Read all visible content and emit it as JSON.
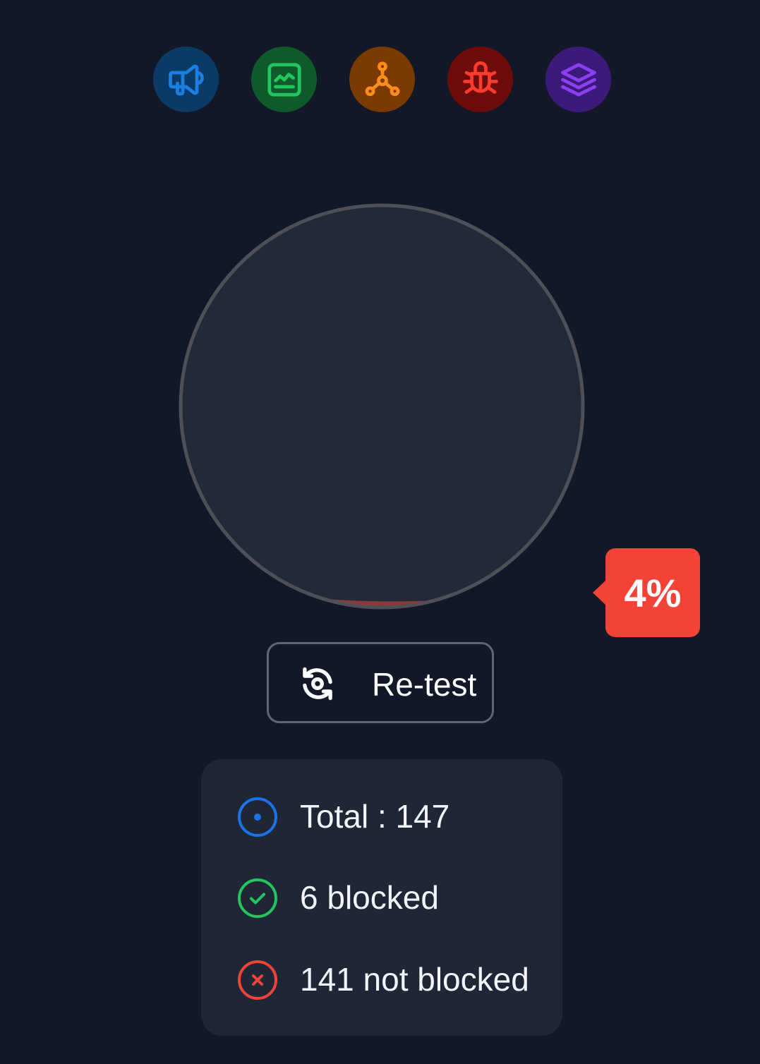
{
  "categories": [
    {
      "name": "marketing",
      "icon": "megaphone-icon",
      "bg": "#0c3a66",
      "color": "#1a7fe0"
    },
    {
      "name": "analytics",
      "icon": "chart-icon",
      "bg": "#0f5a2a",
      "color": "#22c55e"
    },
    {
      "name": "networks",
      "icon": "nodes-icon",
      "bg": "#7a3a00",
      "color": "#ff8c1a"
    },
    {
      "name": "bugs",
      "icon": "bug-icon",
      "bg": "#6e0b0b",
      "color": "#ff3b30"
    },
    {
      "name": "layers",
      "icon": "layers-icon",
      "bg": "#3b1a7a",
      "color": "#8b3ff0"
    }
  ],
  "gauge": {
    "fill_fraction": 0.04,
    "fill_color": "#ff4433",
    "ring_color": "#4f4f57",
    "inner_color": "#222a38"
  },
  "badge": {
    "text": "4%",
    "bg": "#f44336"
  },
  "retest": {
    "label": "Re-test",
    "icon": "refresh-icon"
  },
  "stats": {
    "total": {
      "text": "Total : 147",
      "icon": "target-icon",
      "color": "#1a73e8"
    },
    "blocked": {
      "text": "6 blocked",
      "icon": "check-circle-icon",
      "color": "#22c55e"
    },
    "not_blocked": {
      "text": "141 not blocked",
      "icon": "x-circle-icon",
      "color": "#f44336"
    }
  }
}
